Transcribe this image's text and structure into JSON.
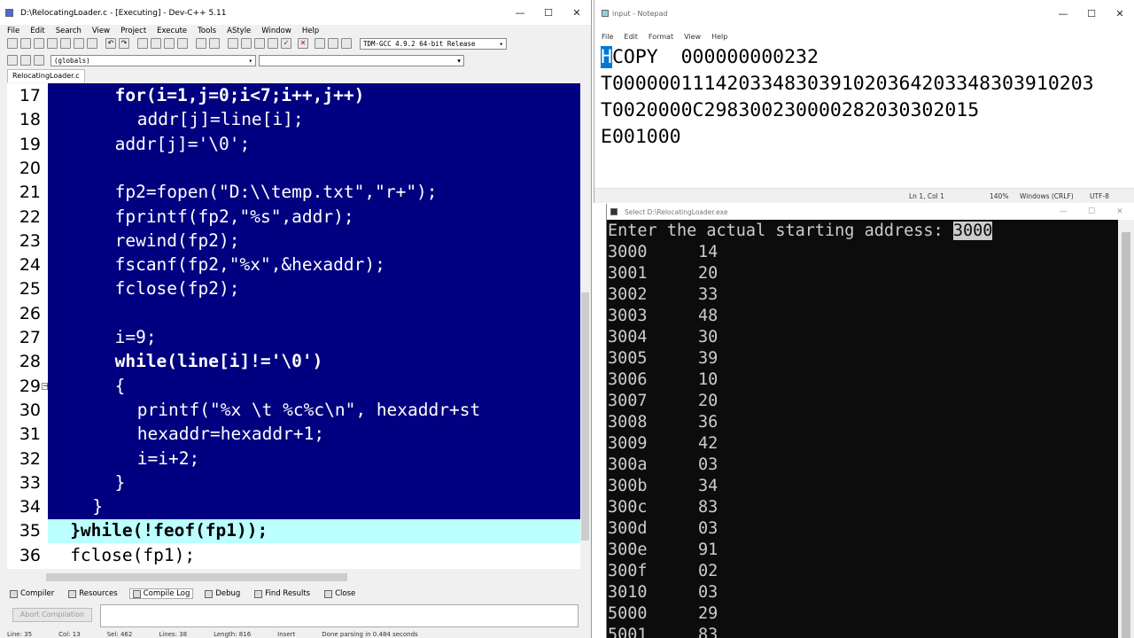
{
  "devcpp": {
    "title": "D:\\RelocatingLoader.c - [Executing] - Dev-C++ 5.11",
    "menu": [
      "File",
      "Edit",
      "Search",
      "View",
      "Project",
      "Execute",
      "Tools",
      "AStyle",
      "Window",
      "Help"
    ],
    "compiler": "TDM-GCC 4.9.2 64-bit Release",
    "scope": "(globals)",
    "file_tab": "RelocatingLoader.c",
    "line_numbers": [
      "17",
      "18",
      "19",
      "20",
      "21",
      "22",
      "23",
      "24",
      "25",
      "26",
      "27",
      "28",
      "29",
      "30",
      "31",
      "32",
      "33",
      "34",
      "35",
      "36"
    ],
    "code_lines": [
      "for(i=1,j=0;i<7;i++,j++)",
      "addr[j]=line[i];",
      "addr[j]='\\0';",
      "",
      "fp2=fopen(\"D:\\\\temp.txt\",\"r+\");",
      "fprintf(fp2,\"%s\",addr);",
      "rewind(fp2);",
      "fscanf(fp2,\"%x\",&hexaddr);",
      "fclose(fp2);",
      "",
      "i=9;",
      "while(line[i]!='\\0')",
      "{",
      "printf(\"%x \\t %c%c\\n\", hexaddr+st",
      "hexaddr=hexaddr+1;",
      "i=i+2;",
      "}",
      "}",
      "}while(!feof(fp1));",
      "fclose(fp1);"
    ],
    "bottom_tabs": [
      "Compiler",
      "Resources",
      "Compile Log",
      "Debug",
      "Find Results",
      "Close"
    ],
    "abort_label": "Abort Compilation",
    "status": [
      "Line: 35",
      "Col: 13",
      "Sel: 462",
      "Lines: 38",
      "Length: 816",
      "Insert",
      "Done parsing in 0.484 seconds"
    ]
  },
  "notepad": {
    "title": "input - Notepad",
    "menu": [
      "File",
      "Edit",
      "Format",
      "View",
      "Help"
    ],
    "lines": [
      "COPY  000000000232",
      "T000000111420334830391020364203348303910203",
      "T0020000C298300230000282030302015",
      "E001000"
    ],
    "first_char": "H",
    "status": {
      "pos": "Ln 1, Col 1",
      "zoom": "140%",
      "eol": "Windows (CRLF)",
      "enc": "UTF-8"
    }
  },
  "console": {
    "title": "Select D:\\RelocatingLoader.exe",
    "prompt": "Enter the actual starting address: ",
    "input": "3000",
    "rows": [
      [
        "3000",
        "14"
      ],
      [
        "3001",
        "20"
      ],
      [
        "3002",
        "33"
      ],
      [
        "3003",
        "48"
      ],
      [
        "3004",
        "30"
      ],
      [
        "3005",
        "39"
      ],
      [
        "3006",
        "10"
      ],
      [
        "3007",
        "20"
      ],
      [
        "3008",
        "36"
      ],
      [
        "3009",
        "42"
      ],
      [
        "300a",
        "03"
      ],
      [
        "300b",
        "34"
      ],
      [
        "300c",
        "83"
      ],
      [
        "300d",
        "03"
      ],
      [
        "300e",
        "91"
      ],
      [
        "300f",
        "02"
      ],
      [
        "3010",
        "03"
      ],
      [
        "5000",
        "29"
      ],
      [
        "5001",
        "83"
      ]
    ]
  },
  "colors": {
    "selection": "#000080",
    "current_line": "#bbffff",
    "console_bg": "#0c0c0c"
  }
}
